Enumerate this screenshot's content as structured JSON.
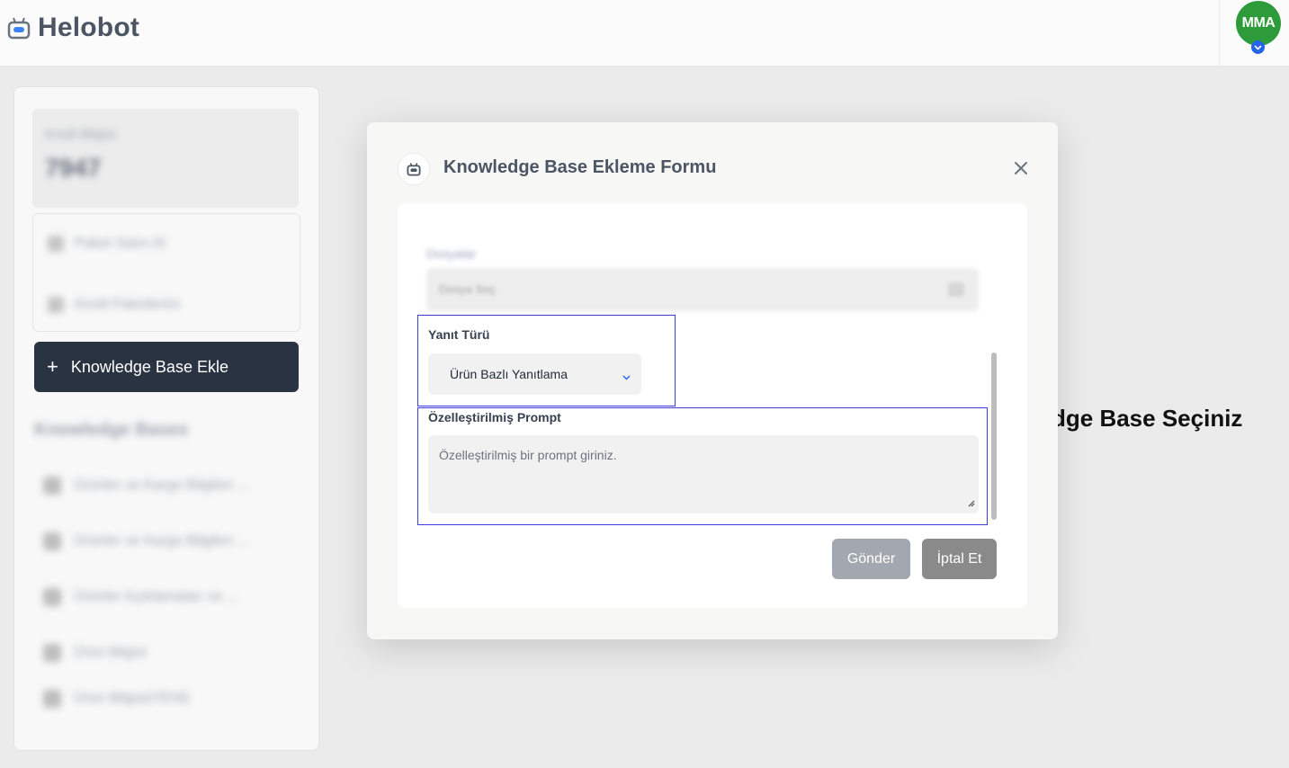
{
  "header": {
    "app_name": "Helobot",
    "logo_icon": "robot-icon",
    "avatar_initials": "MMA",
    "avatar_color": "#2e9b3a",
    "avatar_badge_icon": "chevron-down-icon"
  },
  "sidebar": {
    "credit_label": "Kredi Bilgisi",
    "credit_value": "7947",
    "menu": [
      {
        "label": "Paket Satın Al",
        "icon": "gear-icon"
      },
      {
        "label": "Kredi Paketlerim",
        "icon": "package-icon"
      }
    ],
    "add_button_label": "Knowledge Base Ekle",
    "kb_heading": "Knowledge Bases",
    "kb_items": [
      {
        "label": "Ürünler ve Kargo Bilgileri ..."
      },
      {
        "label": "Ürünler ve Kargo Bilgileri ..."
      },
      {
        "label": "Ürünler Açıklamaları ve ..."
      },
      {
        "label": "Ürün Bilgisi"
      },
      {
        "label": "Ürün Bilgisi(YENİ)"
      }
    ]
  },
  "main": {
    "background_title": "dge Base Seçiniz"
  },
  "modal": {
    "title": "Knowledge Base Ekleme Formu",
    "icon": "robot-icon",
    "blurred_label": "Dosyalar",
    "blurred_input": "Dosya Seç",
    "response_type": {
      "label": "Yanıt Türü",
      "value": "Ürün Bazlı Yanıtlama"
    },
    "custom_prompt": {
      "label": "Özelleştirilmiş Prompt",
      "placeholder": "Özelleştirilmiş bir prompt giriniz."
    },
    "submit_label": "Gönder",
    "cancel_label": "İptal Et"
  },
  "colors": {
    "accent_dark": "#2a3341",
    "highlight_border": "#3b3fd8",
    "submit_bg": "#a3a8b0",
    "cancel_bg": "#8a8a8a"
  }
}
